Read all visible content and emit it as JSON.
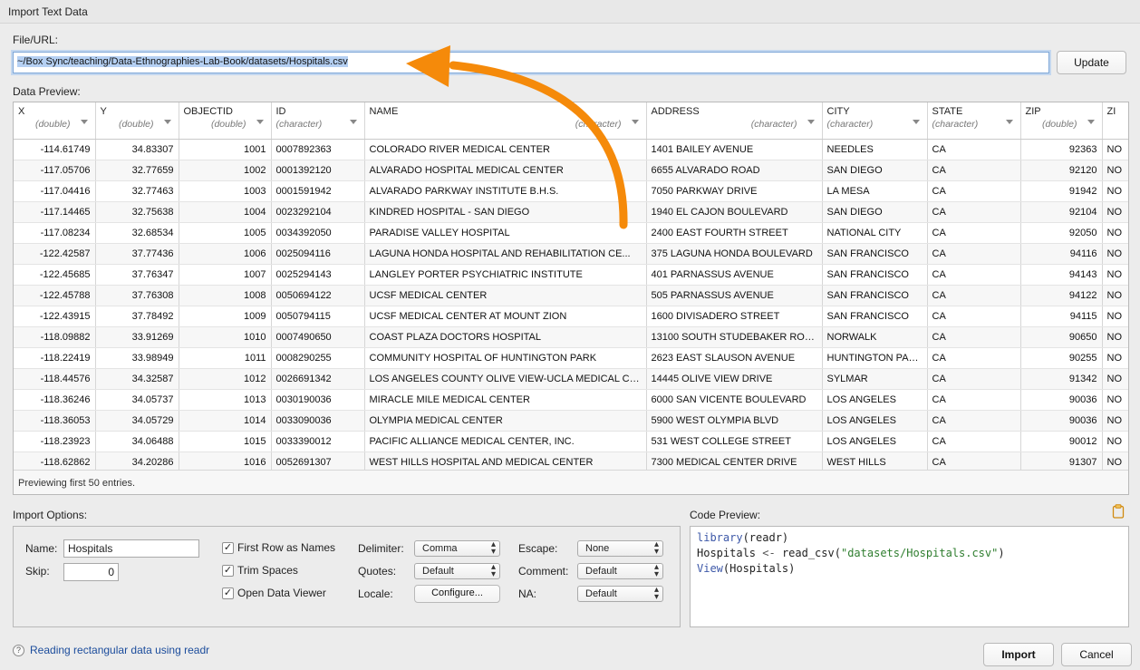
{
  "window": {
    "title": "Import Text Data"
  },
  "file_url": {
    "label": "File/URL:",
    "value": "~/Box Sync/teaching/Data-Ethnographies-Lab-Book/datasets/Hospitals.csv",
    "update_label": "Update"
  },
  "data_preview": {
    "label": "Data Preview:",
    "columns": [
      {
        "name": "X",
        "type": "(double)"
      },
      {
        "name": "Y",
        "type": "(double)"
      },
      {
        "name": "OBJECTID",
        "type": "(double)"
      },
      {
        "name": "ID",
        "type": "(character)"
      },
      {
        "name": "NAME",
        "type": "(character)"
      },
      {
        "name": "ADDRESS",
        "type": "(character)"
      },
      {
        "name": "CITY",
        "type": "(character)"
      },
      {
        "name": "STATE",
        "type": "(character)"
      },
      {
        "name": "ZIP",
        "type": "(double)"
      },
      {
        "name": "ZI",
        "type": ""
      }
    ],
    "rows": [
      [
        "-114.61749",
        "34.83307",
        "1001",
        "0007892363",
        "COLORADO RIVER MEDICAL CENTER",
        "1401 BAILEY AVENUE",
        "NEEDLES",
        "CA",
        "92363",
        "NO"
      ],
      [
        "-117.05706",
        "32.77659",
        "1002",
        "0001392120",
        "ALVARADO HOSPITAL MEDICAL CENTER",
        "6655 ALVARADO ROAD",
        "SAN DIEGO",
        "CA",
        "92120",
        "NO"
      ],
      [
        "-117.04416",
        "32.77463",
        "1003",
        "0001591942",
        "ALVARADO PARKWAY INSTITUTE B.H.S.",
        "7050 PARKWAY DRIVE",
        "LA MESA",
        "CA",
        "91942",
        "NO"
      ],
      [
        "-117.14465",
        "32.75638",
        "1004",
        "0023292104",
        "KINDRED HOSPITAL - SAN DIEGO",
        "1940 EL CAJON BOULEVARD",
        "SAN DIEGO",
        "CA",
        "92104",
        "NO"
      ],
      [
        "-117.08234",
        "32.68534",
        "1005",
        "0034392050",
        "PARADISE VALLEY HOSPITAL",
        "2400 EAST FOURTH STREET",
        "NATIONAL CITY",
        "CA",
        "92050",
        "NO"
      ],
      [
        "-122.42587",
        "37.77436",
        "1006",
        "0025094116",
        "LAGUNA HONDA HOSPITAL AND REHABILITATION CE...",
        "375 LAGUNA HONDA BOULEVARD",
        "SAN FRANCISCO",
        "CA",
        "94116",
        "NO"
      ],
      [
        "-122.45685",
        "37.76347",
        "1007",
        "0025294143",
        "LANGLEY PORTER PSYCHIATRIC INSTITUTE",
        "401 PARNASSUS AVENUE",
        "SAN FRANCISCO",
        "CA",
        "94143",
        "NO"
      ],
      [
        "-122.45788",
        "37.76308",
        "1008",
        "0050694122",
        "UCSF MEDICAL CENTER",
        "505 PARNASSUS AVENUE",
        "SAN FRANCISCO",
        "CA",
        "94122",
        "NO"
      ],
      [
        "-122.43915",
        "37.78492",
        "1009",
        "0050794115",
        "UCSF MEDICAL CENTER AT MOUNT ZION",
        "1600 DIVISADERO STREET",
        "SAN FRANCISCO",
        "CA",
        "94115",
        "NO"
      ],
      [
        "-118.09882",
        "33.91269",
        "1010",
        "0007490650",
        "COAST PLAZA DOCTORS HOSPITAL",
        "13100 SOUTH STUDEBAKER ROAD",
        "NORWALK",
        "CA",
        "90650",
        "NO"
      ],
      [
        "-118.22419",
        "33.98949",
        "1011",
        "0008290255",
        "COMMUNITY HOSPITAL OF HUNTINGTON PARK",
        "2623 EAST SLAUSON AVENUE",
        "HUNTINGTON PARK",
        "CA",
        "90255",
        "NO"
      ],
      [
        "-118.44576",
        "34.32587",
        "1012",
        "0026691342",
        "LOS ANGELES COUNTY OLIVE VIEW-UCLA MEDICAL CE...",
        "14445 OLIVE VIEW DRIVE",
        "SYLMAR",
        "CA",
        "91342",
        "NO"
      ],
      [
        "-118.36246",
        "34.05737",
        "1013",
        "0030190036",
        "MIRACLE MILE MEDICAL CENTER",
        "6000 SAN VICENTE BOULEVARD",
        "LOS ANGELES",
        "CA",
        "90036",
        "NO"
      ],
      [
        "-118.36053",
        "34.05729",
        "1014",
        "0033090036",
        "OLYMPIA MEDICAL CENTER",
        "5900 WEST OLYMPIA BLVD",
        "LOS ANGELES",
        "CA",
        "90036",
        "NO"
      ],
      [
        "-118.23923",
        "34.06488",
        "1015",
        "0033390012",
        "PACIFIC ALLIANCE MEDICAL CENTER, INC.",
        "531 WEST COLLEGE STREET",
        "LOS ANGELES",
        "CA",
        "90012",
        "NO"
      ],
      [
        "-118.62862",
        "34.20286",
        "1016",
        "0052691307",
        "WEST HILLS HOSPITAL AND MEDICAL CENTER",
        "7300 MEDICAL CENTER DRIVE",
        "WEST HILLS",
        "CA",
        "91307",
        "NO"
      ]
    ],
    "footer": "Previewing first 50 entries."
  },
  "import_options": {
    "label": "Import Options:",
    "name_label": "Name:",
    "name_value": "Hospitals",
    "skip_label": "Skip:",
    "skip_value": "0",
    "first_row_label": "First Row as Names",
    "trim_spaces_label": "Trim Spaces",
    "open_viewer_label": "Open Data Viewer",
    "delimiter_label": "Delimiter:",
    "delimiter_value": "Comma",
    "quotes_label": "Quotes:",
    "quotes_value": "Default",
    "locale_label": "Locale:",
    "locale_button": "Configure...",
    "escape_label": "Escape:",
    "escape_value": "None",
    "comment_label": "Comment:",
    "comment_value": "Default",
    "na_label": "NA:",
    "na_value": "Default",
    "checkmark": "✓"
  },
  "code_preview": {
    "label": "Code Preview:",
    "line1_fn": "library",
    "line1_arg": "(readr)",
    "line2_var": "Hospitals",
    "line2_op": " <- ",
    "line2_fn": "read_csv(",
    "line2_str": "\"datasets/Hospitals.csv\"",
    "line2_end": ")",
    "line3_fn": "View",
    "line3_arg": "(Hospitals)"
  },
  "footer": {
    "help_icon": "?",
    "help_text": "Reading rectangular data using readr",
    "import_label": "Import",
    "cancel_label": "Cancel"
  },
  "colors": {
    "arrow": "#f58a0a",
    "link": "#1b4c9c"
  }
}
